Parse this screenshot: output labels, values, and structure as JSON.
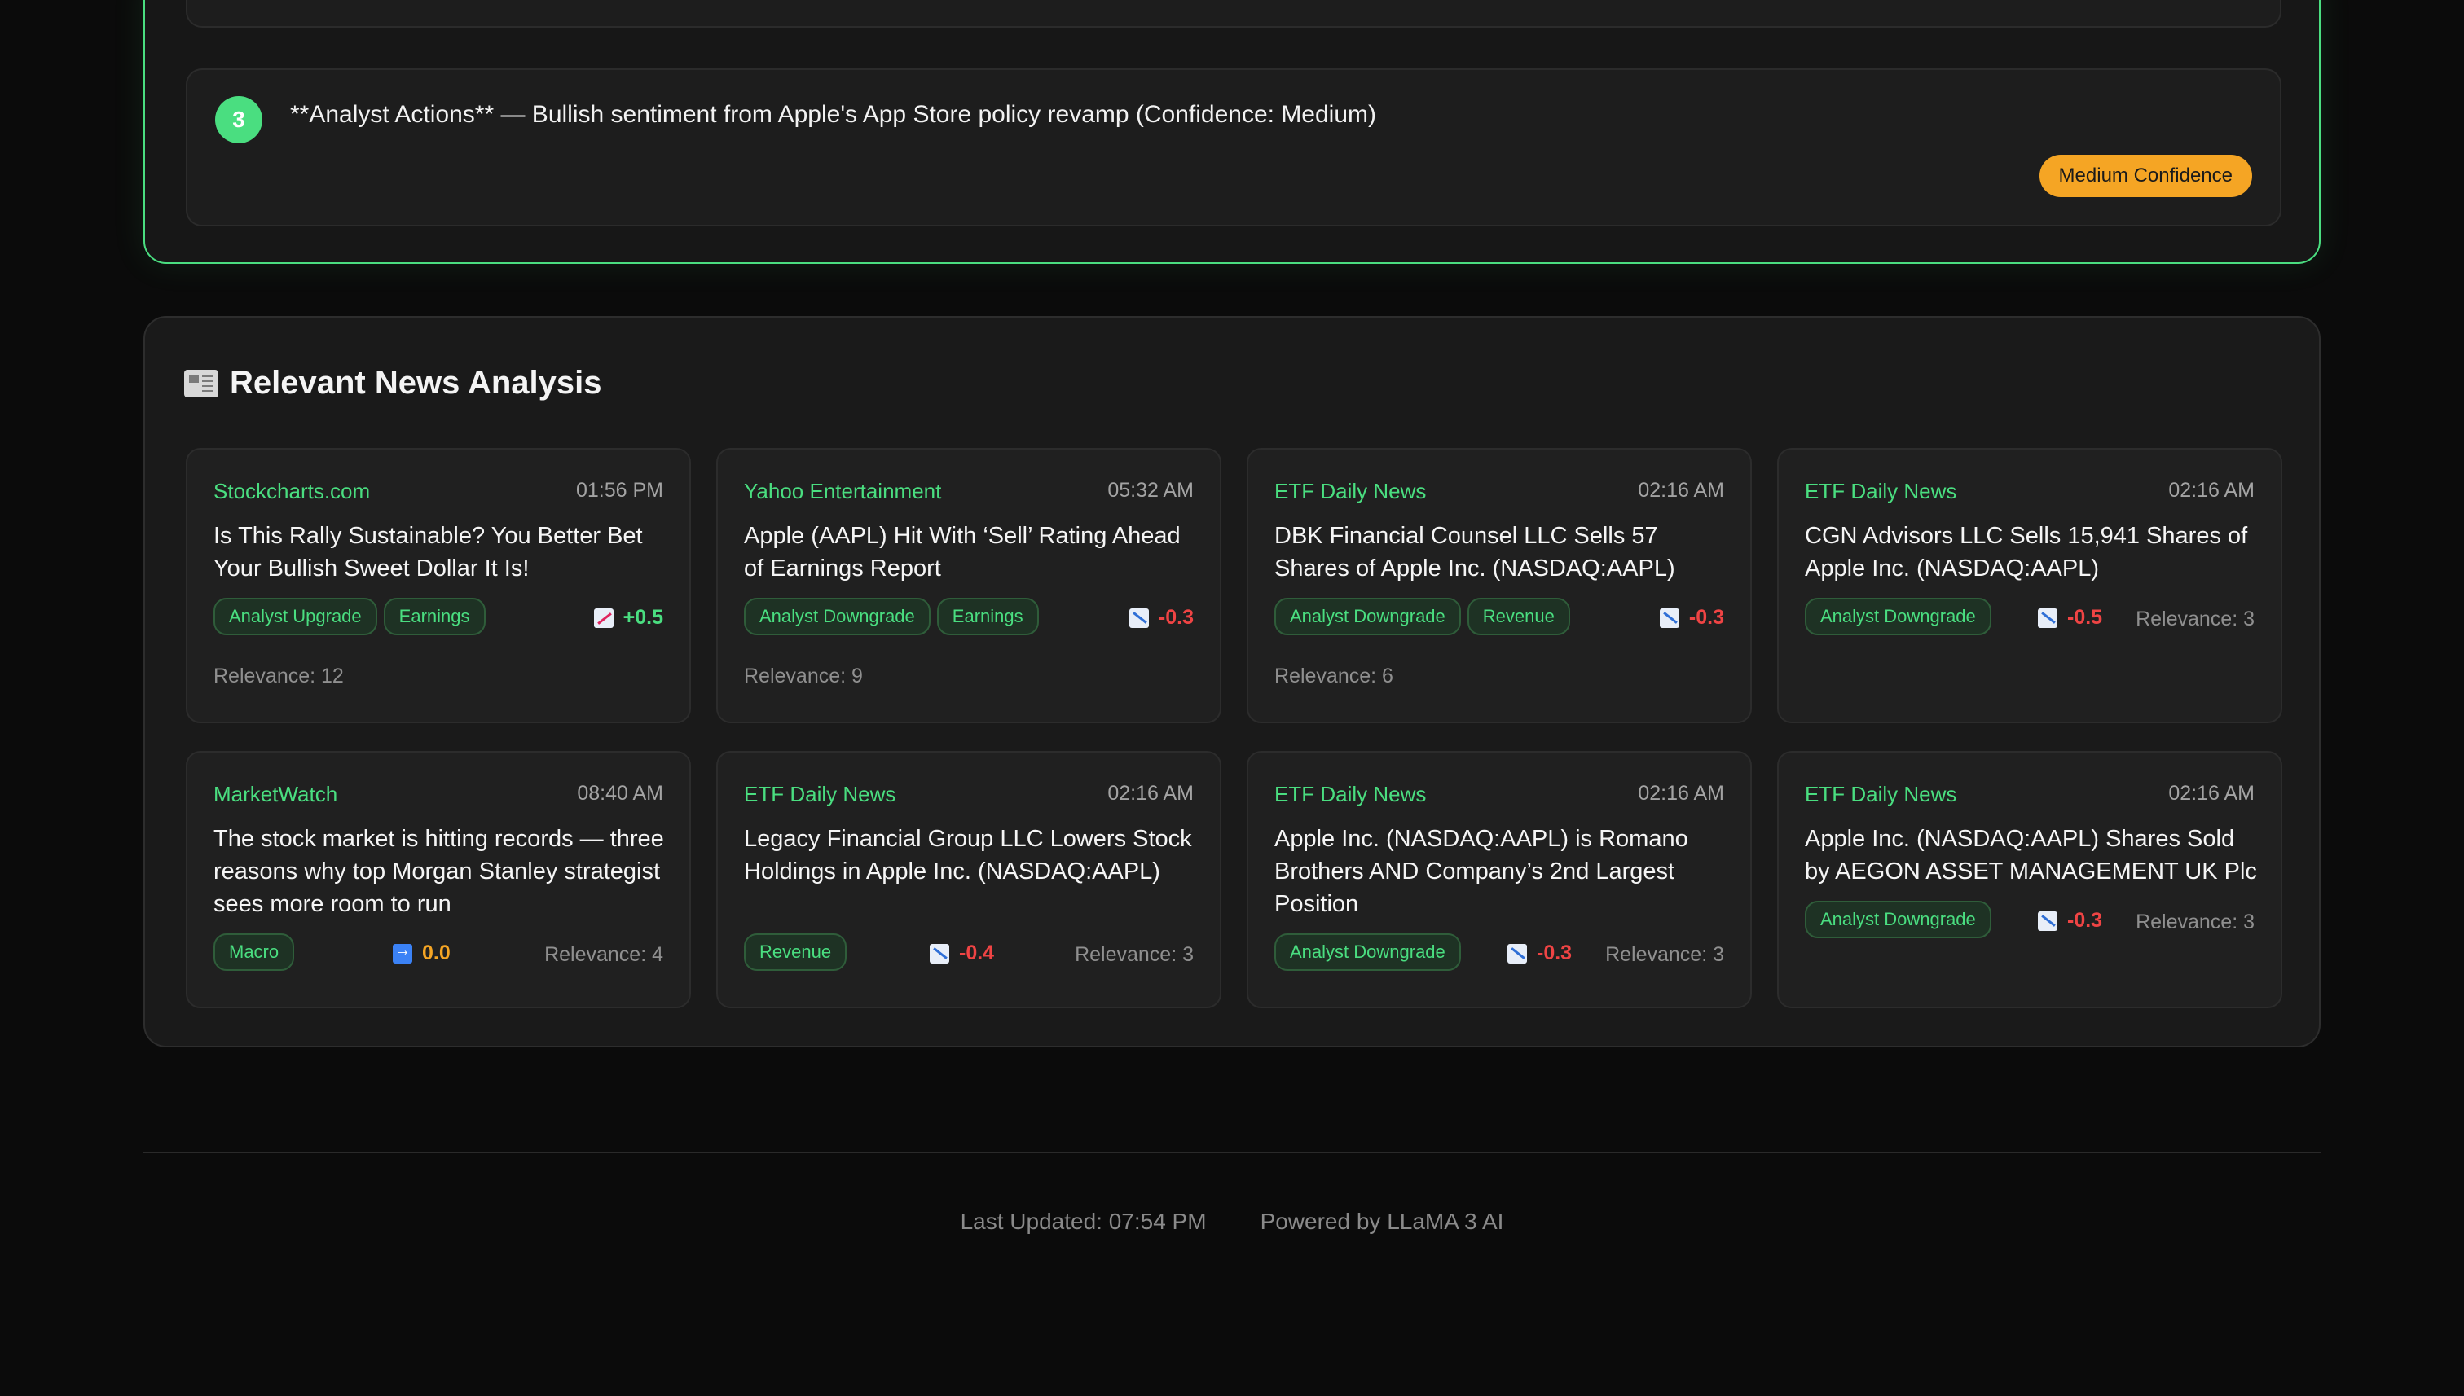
{
  "insight": {
    "number": "3",
    "text": "**Analyst Actions** — Bullish sentiment from Apple's App Store policy revamp (Confidence: Medium)",
    "confidence_badge": "Medium Confidence"
  },
  "news_section": {
    "title": "Relevant News Analysis",
    "icon": "newspaper-icon",
    "cards": [
      {
        "source": "Stockcharts.com",
        "time": "01:56 PM",
        "title": "Is This Rally Sustainable? You Better Bet Your Bullish Sweet Dollar It Is!",
        "tags": [
          "Analyst Upgrade",
          "Earnings"
        ],
        "sentiment": "+0.5",
        "sentiment_icon": "chart-up-icon",
        "relevance": "Relevance: 12"
      },
      {
        "source": "Yahoo Entertainment",
        "time": "05:32 AM",
        "title": "Apple (AAPL) Hit With ‘Sell’ Rating Ahead of Earnings Report",
        "tags": [
          "Analyst Downgrade",
          "Earnings"
        ],
        "sentiment": "-0.3",
        "sentiment_icon": "chart-down-icon",
        "relevance": "Relevance: 9"
      },
      {
        "source": "ETF Daily News",
        "time": "02:16 AM",
        "title": "DBK Financial Counsel LLC Sells 57 Shares of Apple Inc. (NASDAQ:AAPL)",
        "tags": [
          "Analyst Downgrade",
          "Revenue"
        ],
        "sentiment": "-0.3",
        "sentiment_icon": "chart-down-icon",
        "relevance": "Relevance: 6"
      },
      {
        "source": "ETF Daily News",
        "time": "02:16 AM",
        "title": "CGN Advisors LLC Sells 15,941 Shares of Apple Inc. (NASDAQ:AAPL)",
        "tags": [
          "Analyst Downgrade"
        ],
        "sentiment": "-0.5",
        "sentiment_icon": "chart-down-icon",
        "relevance": "Relevance: 3"
      },
      {
        "source": "MarketWatch",
        "time": "08:40 AM",
        "title": "The stock market is hitting records — three reasons why top Morgan Stanley strategist sees more room to run",
        "tags": [
          "Macro"
        ],
        "sentiment": "0.0",
        "sentiment_icon": "arrow-right-icon",
        "relevance": "Relevance: 4"
      },
      {
        "source": "ETF Daily News",
        "time": "02:16 AM",
        "title": "Legacy Financial Group LLC Lowers Stock Holdings in Apple Inc. (NASDAQ:AAPL)",
        "tags": [
          "Revenue"
        ],
        "sentiment": "-0.4",
        "sentiment_icon": "chart-down-icon",
        "relevance": "Relevance: 3"
      },
      {
        "source": "ETF Daily News",
        "time": "02:16 AM",
        "title": "Apple Inc. (NASDAQ:AAPL) is Romano Brothers AND Company’s 2nd Largest Position",
        "tags": [
          "Analyst Downgrade"
        ],
        "sentiment": "-0.3",
        "sentiment_icon": "chart-down-icon",
        "relevance": "Relevance: 3"
      },
      {
        "source": "ETF Daily News",
        "time": "02:16 AM",
        "title": "Apple Inc. (NASDAQ:AAPL) Shares Sold by AEGON ASSET MANAGEMENT UK Plc",
        "tags": [
          "Analyst Downgrade"
        ],
        "sentiment": "-0.3",
        "sentiment_icon": "chart-down-icon",
        "relevance": "Relevance: 3"
      }
    ]
  },
  "footer": {
    "last_updated": "Last Updated: 07:54 PM",
    "powered_by": "Powered by LLaMA 3 AI"
  },
  "colors": {
    "accent_green": "#4ade80",
    "negative_red": "#ef4444",
    "neutral_orange": "#f5a524"
  }
}
